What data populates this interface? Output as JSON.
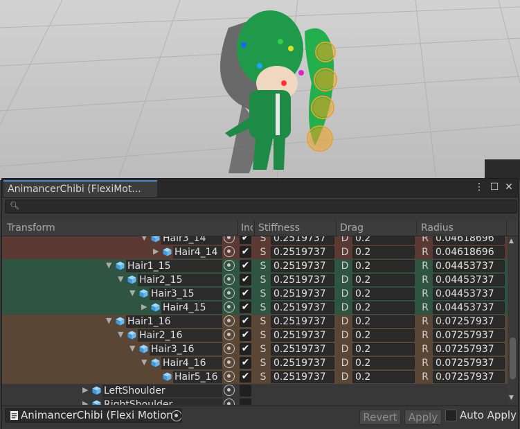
{
  "window": {
    "tab_title": "AnimancerChibi (FlexiMot...",
    "menu_icon": "kebab-icon",
    "maximize_icon": "maximize-icon",
    "close_icon": "close-icon"
  },
  "search": {
    "value": "",
    "icon": "search-icon"
  },
  "columns": [
    "Transform",
    "Inc",
    "Stiffness",
    "Drag",
    "Radius"
  ],
  "field_labels": {
    "stiffness": "S",
    "drag": "D",
    "radius": "R"
  },
  "rows": [
    {
      "name": "Hair3_14",
      "depth": 3,
      "expanded": true,
      "included": true,
      "stiffness": "0.2519737",
      "drag": "0.2",
      "radius": "0.04618696",
      "group": "red"
    },
    {
      "name": "Hair4_14",
      "depth": 4,
      "expanded": false,
      "included": true,
      "stiffness": "0.2519737",
      "drag": "0.2",
      "radius": "0.04618696",
      "group": "red"
    },
    {
      "name": "Hair1_15",
      "depth": 0,
      "expanded": true,
      "included": true,
      "stiffness": "0.2519737",
      "drag": "0.2",
      "radius": "0.04453737",
      "group": "green"
    },
    {
      "name": "Hair2_15",
      "depth": 1,
      "expanded": true,
      "included": true,
      "stiffness": "0.2519737",
      "drag": "0.2",
      "radius": "0.04453737",
      "group": "green"
    },
    {
      "name": "Hair3_15",
      "depth": 2,
      "expanded": true,
      "included": true,
      "stiffness": "0.2519737",
      "drag": "0.2",
      "radius": "0.04453737",
      "group": "green"
    },
    {
      "name": "Hair4_15",
      "depth": 3,
      "expanded": false,
      "included": true,
      "stiffness": "0.2519737",
      "drag": "0.2",
      "radius": "0.04453737",
      "group": "green"
    },
    {
      "name": "Hair1_16",
      "depth": 0,
      "expanded": true,
      "included": true,
      "stiffness": "0.2519737",
      "drag": "0.2",
      "radius": "0.07257937",
      "group": "brown"
    },
    {
      "name": "Hair2_16",
      "depth": 1,
      "expanded": true,
      "included": true,
      "stiffness": "0.2519737",
      "drag": "0.2",
      "radius": "0.07257937",
      "group": "brown"
    },
    {
      "name": "Hair3_16",
      "depth": 2,
      "expanded": true,
      "included": true,
      "stiffness": "0.2519737",
      "drag": "0.2",
      "radius": "0.07257937",
      "group": "brown"
    },
    {
      "name": "Hair4_16",
      "depth": 3,
      "expanded": true,
      "included": true,
      "stiffness": "0.2519737",
      "drag": "0.2",
      "radius": "0.07257937",
      "group": "brown"
    },
    {
      "name": "Hair5_16",
      "depth": 4,
      "expanded": null,
      "included": true,
      "stiffness": "0.2519737",
      "drag": "0.2",
      "radius": "0.07257937",
      "group": "brown"
    },
    {
      "name": "LeftShoulder",
      "depth": -2,
      "expanded": false,
      "included": false,
      "group": "none"
    },
    {
      "name": "RightShoulder",
      "depth": -2,
      "expanded": false,
      "included": false,
      "group": "none"
    }
  ],
  "group_colors": {
    "red": "#5a3a33",
    "green": "#2f5442",
    "brown": "#5a4634",
    "none": "#383838"
  },
  "footer": {
    "object_name": "AnimancerChibi (Flexi Motion",
    "revert_label": "Revert",
    "apply_label": "Apply",
    "auto_apply_label": "Auto Apply",
    "auto_apply_checked": false
  }
}
